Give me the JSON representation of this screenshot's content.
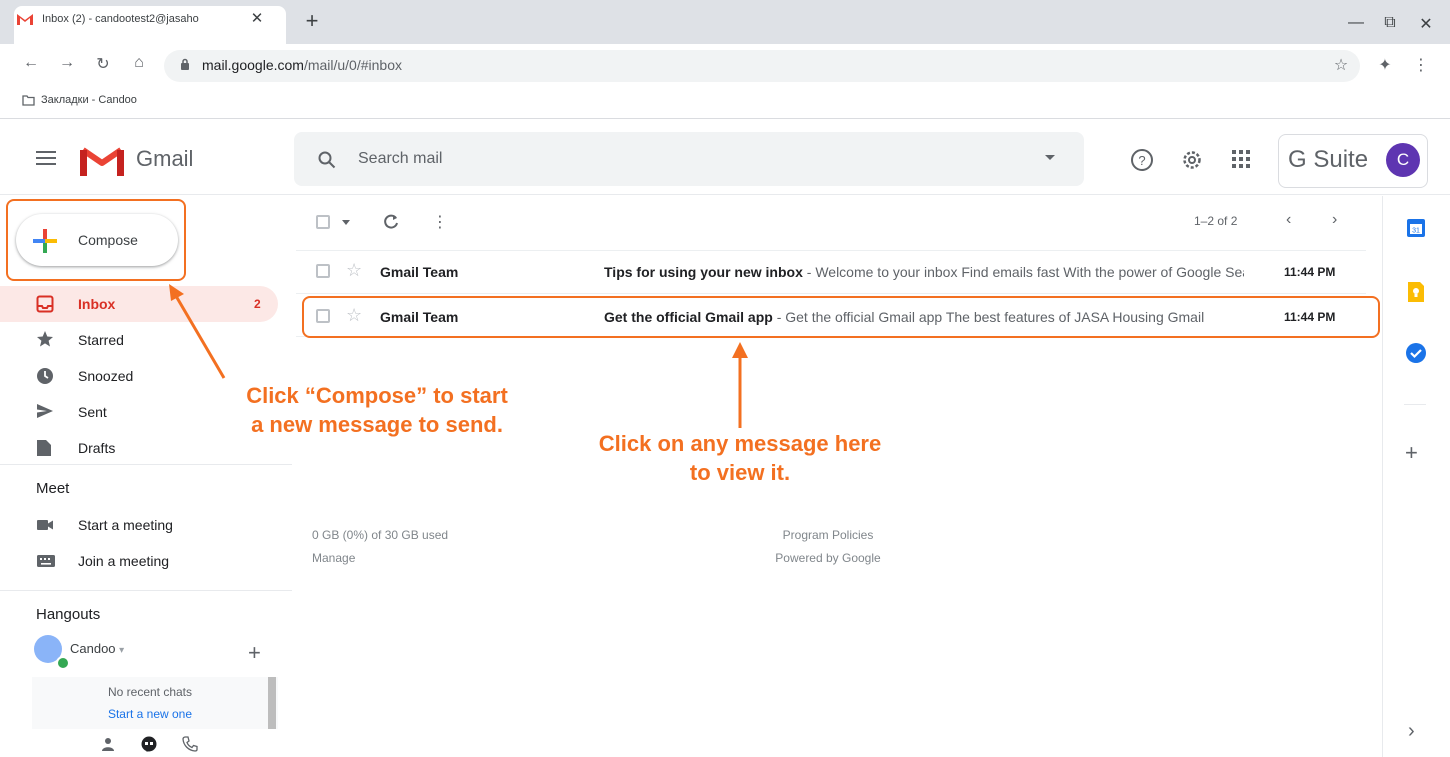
{
  "browser": {
    "tab_title": "Inbox (2) - candootest2@jasaho",
    "tab_close": "✕",
    "new_tab": "+",
    "window_controls": [
      "—",
      "⧉",
      "✕"
    ],
    "url_host": "mail.google.com",
    "url_path": "/mail/u/0/#inbox",
    "bookmark_label": "Закладки - Candoo"
  },
  "header": {
    "app_name": "Gmail",
    "search_placeholder": "Search mail",
    "workspace_label": "G Suite",
    "avatar_letter": "C"
  },
  "sidebar": {
    "compose_label": "Compose",
    "items": [
      {
        "label": "Inbox",
        "count": "2",
        "icon": "inbox-icon"
      },
      {
        "label": "Starred",
        "icon": "star-icon"
      },
      {
        "label": "Snoozed",
        "icon": "clock-icon"
      },
      {
        "label": "Sent",
        "icon": "send-icon"
      },
      {
        "label": "Drafts",
        "icon": "draft-icon"
      }
    ],
    "meet": {
      "title": "Meet",
      "items": [
        {
          "label": "Start a meeting",
          "icon": "video-icon"
        },
        {
          "label": "Join a meeting",
          "icon": "keyboard-icon"
        }
      ]
    },
    "hangouts": {
      "title": "Hangouts",
      "user_name": "Candoo",
      "user_caret": "▾",
      "add": "+",
      "no_recent": "No recent chats",
      "start_new": "Start a new one"
    }
  },
  "mail": {
    "pager_text": "1–2 of 2",
    "messages": [
      {
        "sender": "Gmail Team",
        "subject": "Tips for using your new inbox",
        "snippet": " - Welcome to your inbox Find emails fast With the power of Google Search",
        "time": "11:44 PM"
      },
      {
        "sender": "Gmail Team",
        "subject": "Get the official Gmail app",
        "snippet": " - Get the official Gmail app The best features of JASA Housing Gmail",
        "time": "11:44 PM"
      }
    ],
    "footer": {
      "storage": "0 GB (0%) of 30 GB used",
      "manage": "Manage",
      "policies": "Program Policies",
      "powered": "Powered by Google"
    }
  },
  "annotations": {
    "compose_line1": "Click “Compose” to start",
    "compose_line2": "a new message to send.",
    "message_line1": "Click on any message here",
    "message_line2": "to view it.",
    "color": "#f37021"
  },
  "colors": {
    "gmail_red": "#d93025",
    "selected_bg": "#fce8e6",
    "avatar": "#5e35b1",
    "link": "#1a73e8"
  }
}
